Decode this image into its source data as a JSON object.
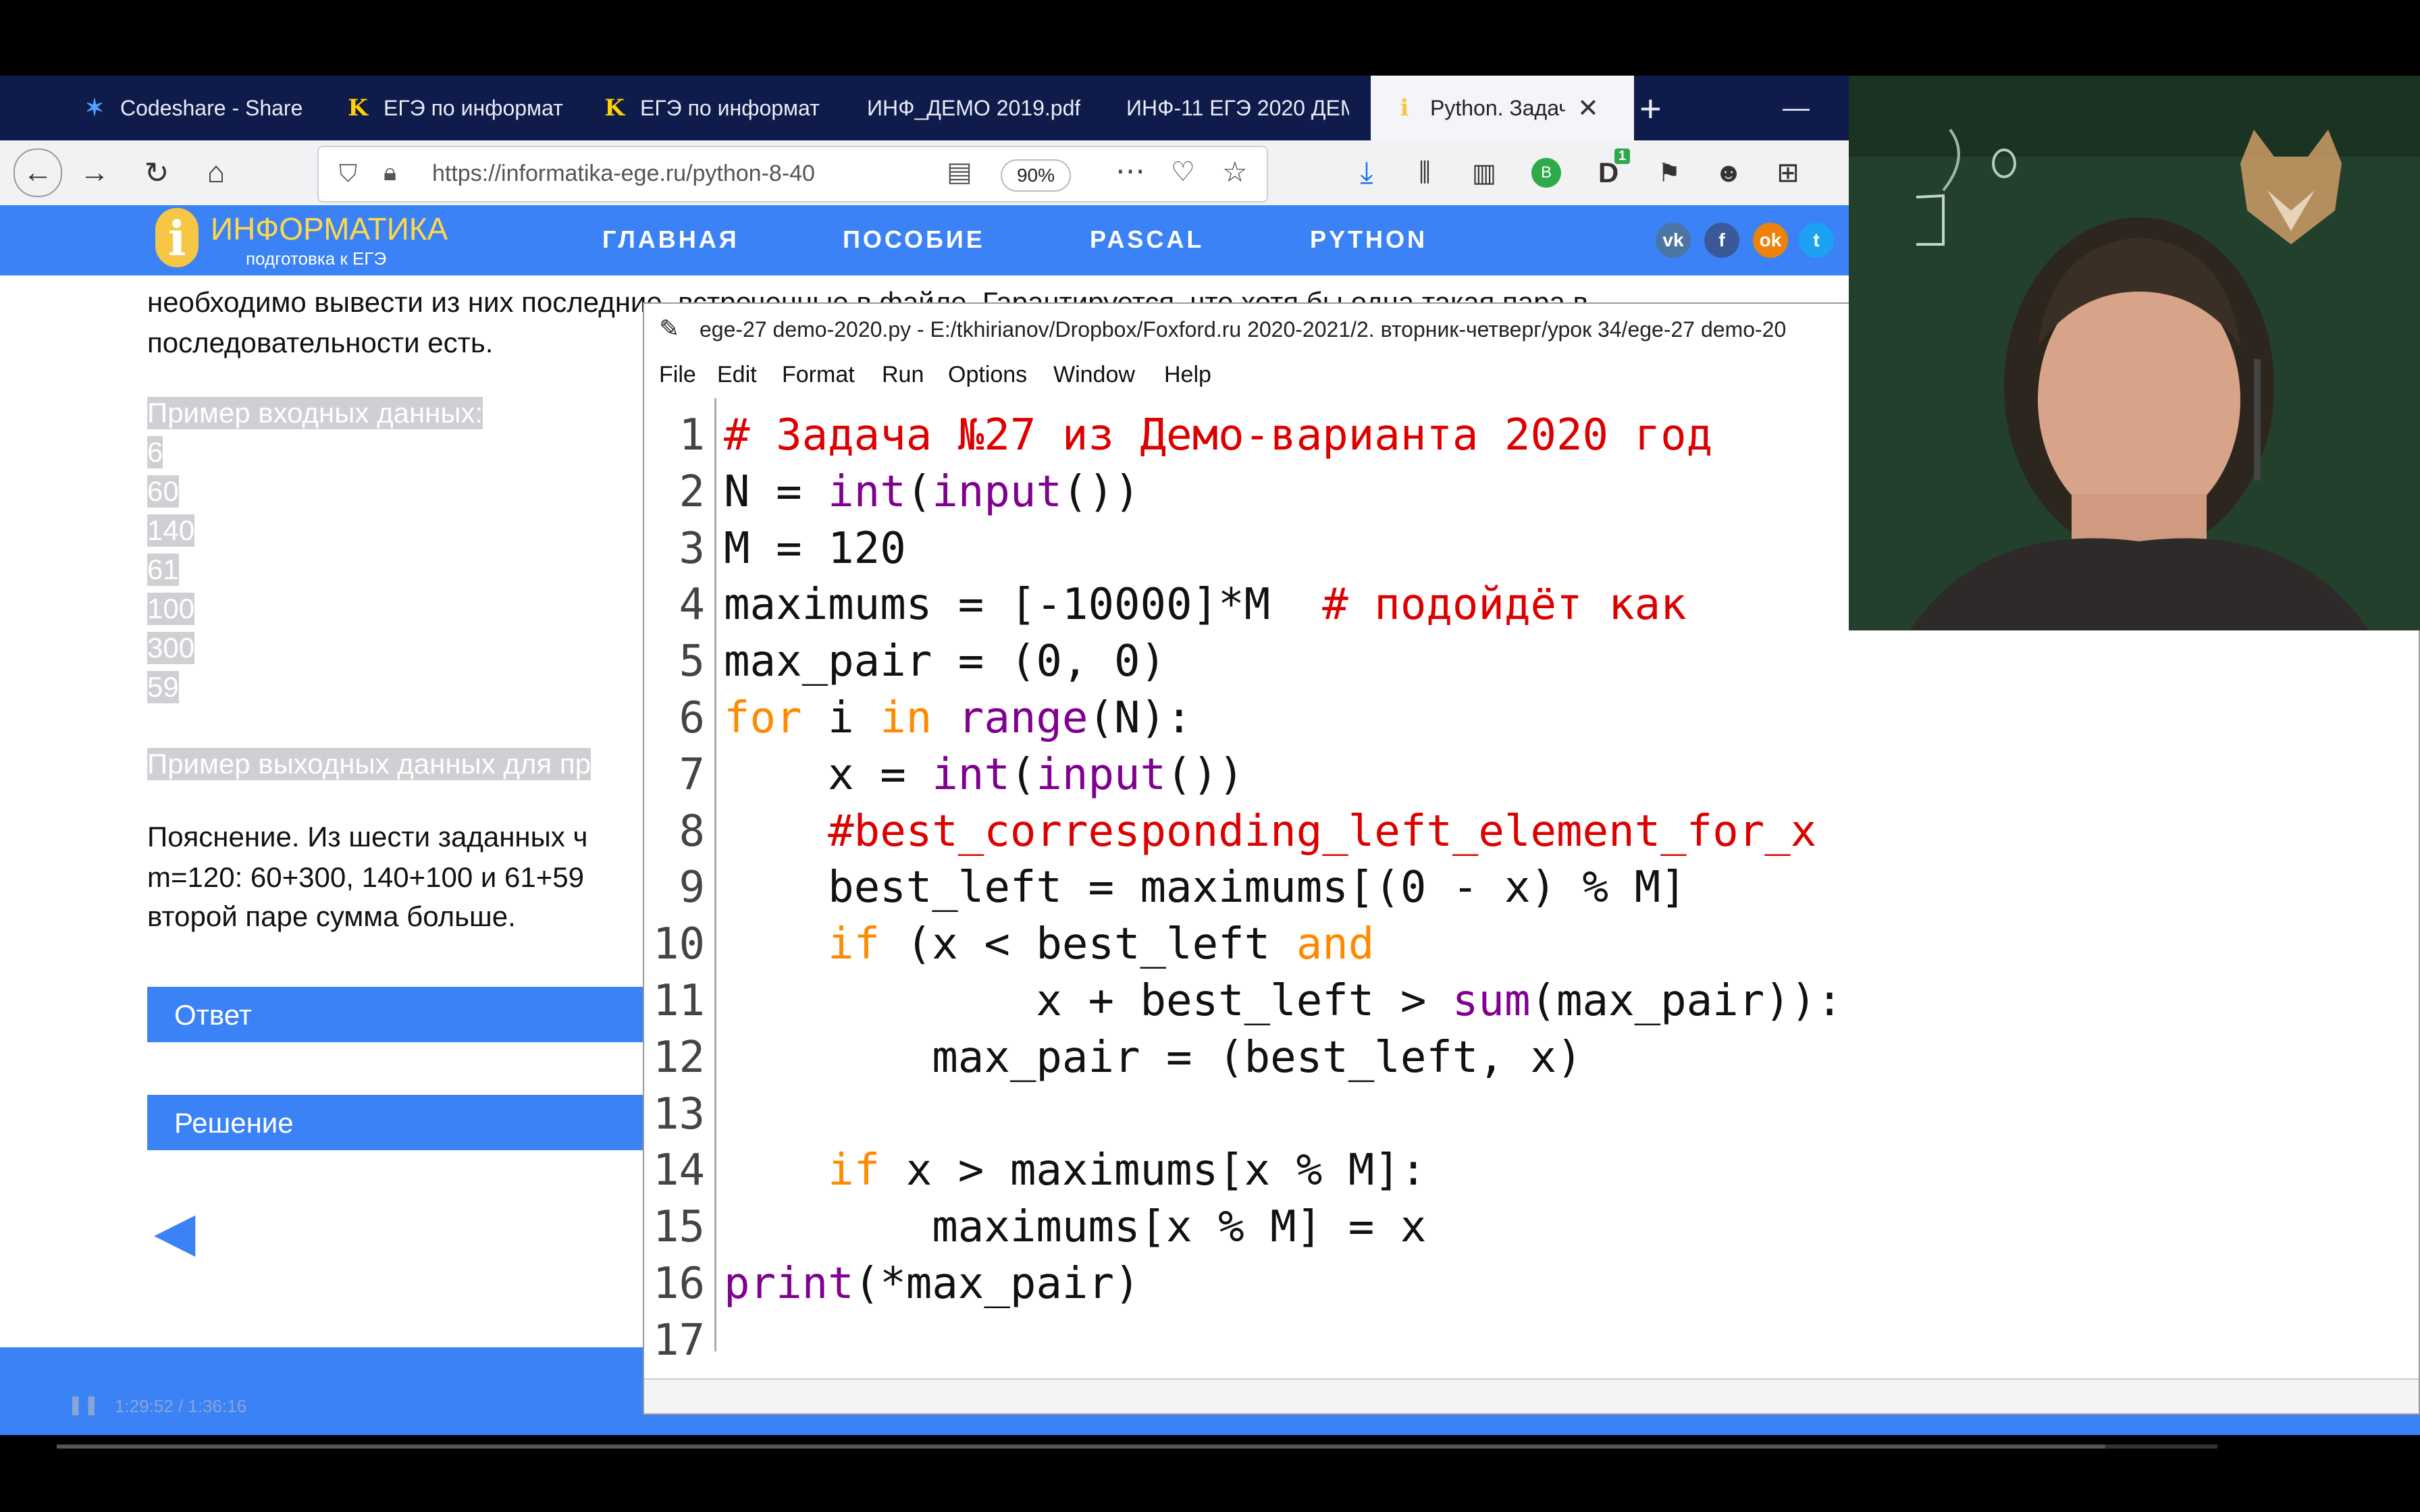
{
  "tabs": [
    {
      "label": "Codeshare - Share",
      "icon": "codeshare-icon"
    },
    {
      "label": "ЕГЭ по информат",
      "icon": "k-icon"
    },
    {
      "label": "ЕГЭ по информат",
      "icon": "k-icon"
    },
    {
      "label": "ИНФ_ДЕМО 2019.pdf",
      "icon": ""
    },
    {
      "label": "ИНФ-11 ЕГЭ 2020 ДЕМ",
      "icon": ""
    },
    {
      "label": "Python. Задач",
      "icon": "bulb-icon",
      "active": true
    }
  ],
  "url": "https://informatika-ege.ru/python-8-40",
  "zoom": "90%",
  "badges": {
    "download_count": "1"
  },
  "site": {
    "logo_title": "ИНФОРМАТИКА",
    "logo_subtitle": "подготовка к ЕГЭ",
    "menu": [
      "ГЛАВНАЯ",
      "ПОСОБИЕ",
      "PASCAL",
      "PYTHON"
    ]
  },
  "page": {
    "line_top": "необходимо вывести из них последние, встреченные в файле. Гарантируется, что хотя бы одна такая пара в",
    "line_top2": "последовательности есть.",
    "input_example_title": "Пример входных данных:",
    "input_values": [
      "6",
      "60",
      "140",
      "61",
      "100",
      "300",
      "59"
    ],
    "output_example_title": "Пример выходных данных для пр",
    "explain": [
      "Пояснение. Из шести заданных ч",
      "m=120: 60+300, 140+100 и 61+59",
      "второй паре сумма больше."
    ],
    "answer_btn": "Ответ",
    "solution_btn": "Решение",
    "back_arrow": "◀"
  },
  "idle": {
    "title": "ege-27 demo-2020.py - E:/tkhirianov/Dropbox/Foxford.ru 2020-2021/2. вторник-четверг/урок 34/ege-27 demo-20",
    "menu": [
      "File",
      "Edit",
      "Format",
      "Run",
      "Options",
      "Window",
      "Help"
    ],
    "line_numbers": [
      "1",
      "2",
      "3",
      "4",
      "5",
      "6",
      "7",
      "8",
      "9",
      "10",
      "11",
      "12",
      "13",
      "14",
      "15",
      "16",
      "17"
    ],
    "code_lines": [
      [
        {
          "t": "# Задача №27 из Демо-варианта 2020 год",
          "c": "cm"
        }
      ],
      [
        {
          "t": "N = ",
          "c": ""
        },
        {
          "t": "int",
          "c": "bi"
        },
        {
          "t": "(",
          "c": ""
        },
        {
          "t": "input",
          "c": "bi"
        },
        {
          "t": "())",
          "c": ""
        }
      ],
      [
        {
          "t": "M = 120",
          "c": ""
        }
      ],
      [
        {
          "t": "maximums = [-10000]*M  ",
          "c": ""
        },
        {
          "t": "# подойдёт как",
          "c": "cm"
        }
      ],
      [
        {
          "t": "max_pair = (0, 0)",
          "c": ""
        }
      ],
      [
        {
          "t": "for",
          "c": "kw"
        },
        {
          "t": " i ",
          "c": ""
        },
        {
          "t": "in",
          "c": "kw"
        },
        {
          "t": " ",
          "c": ""
        },
        {
          "t": "range",
          "c": "bi"
        },
        {
          "t": "(N):",
          "c": ""
        }
      ],
      [
        {
          "t": "    x = ",
          "c": ""
        },
        {
          "t": "int",
          "c": "bi"
        },
        {
          "t": "(",
          "c": ""
        },
        {
          "t": "input",
          "c": "bi"
        },
        {
          "t": "())",
          "c": ""
        }
      ],
      [
        {
          "t": "    #best_corresponding_left_element_for_x",
          "c": "cm"
        }
      ],
      [
        {
          "t": "    best_left = maximums[(0 - x) % M]",
          "c": ""
        }
      ],
      [
        {
          "t": "    ",
          "c": ""
        },
        {
          "t": "if",
          "c": "kw"
        },
        {
          "t": " (x < best_left ",
          "c": ""
        },
        {
          "t": "and",
          "c": "kw"
        }
      ],
      [
        {
          "t": "            x + best_left > ",
          "c": ""
        },
        {
          "t": "sum",
          "c": "bi"
        },
        {
          "t": "(max_pair)):",
          "c": ""
        }
      ],
      [
        {
          "t": "        max_pair = (best_left, x)",
          "c": ""
        }
      ],
      [
        {
          "t": "",
          "c": ""
        }
      ],
      [
        {
          "t": "    ",
          "c": ""
        },
        {
          "t": "if",
          "c": "kw"
        },
        {
          "t": " x > maximums[x % M]:",
          "c": ""
        }
      ],
      [
        {
          "t": "        maximums[x % M] = x",
          "c": ""
        }
      ],
      [
        {
          "t": "print",
          "c": "bi"
        },
        {
          "t": "(*max_pair)",
          "c": ""
        }
      ],
      [
        {
          "t": "",
          "c": ""
        }
      ]
    ]
  },
  "video": {
    "time": "1:29:52 / 1:36:16",
    "progress": 0.948
  }
}
